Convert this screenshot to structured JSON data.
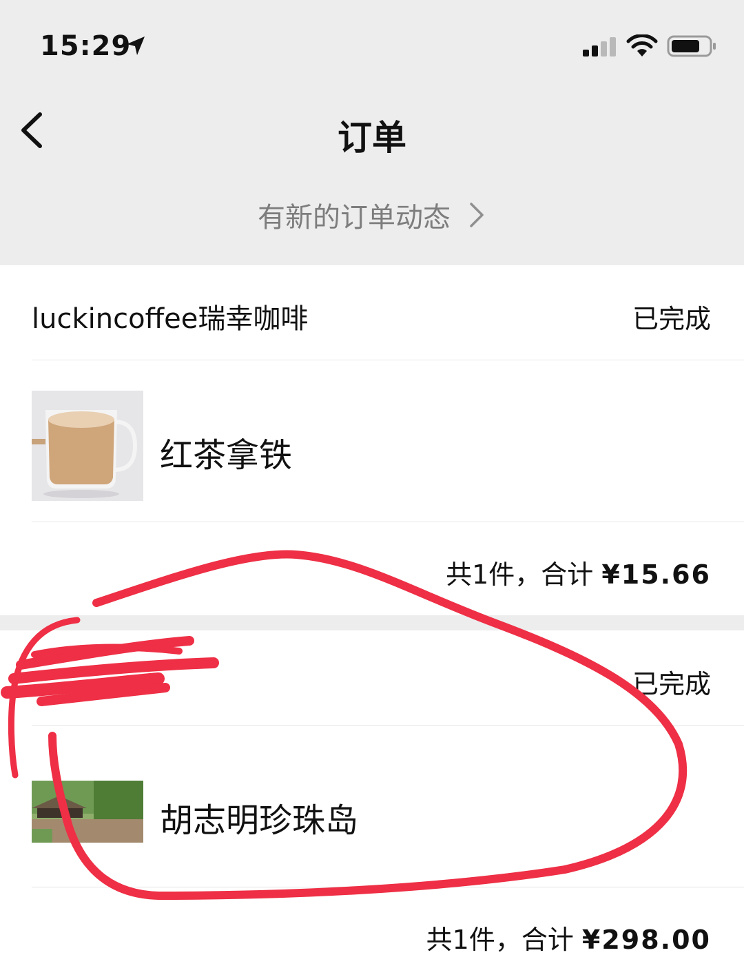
{
  "status_bar": {
    "time": "15:29"
  },
  "nav": {
    "title": "订单"
  },
  "order_news": {
    "label": "有新的订单动态"
  },
  "orders": [
    {
      "store": "luckincoffee瑞幸咖啡",
      "status": "已完成",
      "item_name": "红茶拿铁",
      "summary_prefix": "共1件，合计",
      "total": "¥15.66"
    },
    {
      "store": "",
      "status": "已完成",
      "item_name": "胡志明珍珠岛",
      "summary_prefix": "共1件，合计",
      "total": "¥298.00"
    }
  ],
  "colors": {
    "header_bg": "#ededed",
    "annotation_red": "#ee2f45",
    "secondary_text": "#7d7d7d"
  }
}
